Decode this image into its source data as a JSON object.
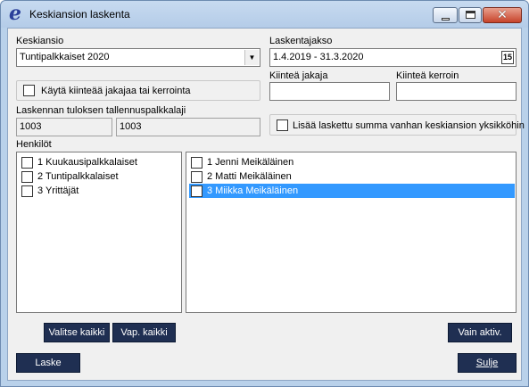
{
  "window": {
    "title": "Keskiansion laskenta",
    "icon": "e-app-icon",
    "close_glyph": "✕"
  },
  "keskiansio": {
    "label": "Keskiansio",
    "value": "Tuntipalkkaiset 2020",
    "dropdown_glyph": "▼"
  },
  "laskentajakso": {
    "label": "Laskentajakso",
    "value": "1.4.2019 - 31.3.2020",
    "calendar_glyph": "15"
  },
  "kiintea_jakaja": {
    "label": "Kiinteä jakaja",
    "value": ""
  },
  "kiintea_kerroin": {
    "label": "Kiinteä kerroin",
    "value": ""
  },
  "use_fixed": {
    "label": "Käytä kiinteää jakajaa tai kerrointa",
    "checked": false
  },
  "tallennus": {
    "label": "Laskennan tuloksen tallennuspalkkalaji",
    "code": "1003",
    "value": "1003"
  },
  "add_sum": {
    "label": "Lisää laskettu summa vanhan keskiansion yksikköhin",
    "checked": false
  },
  "henkilot": {
    "label": "Henkilöt",
    "groups": [
      {
        "label": "1 Kuukausipalkkalaiset",
        "checked": false
      },
      {
        "label": "2 Tuntipalkkalaiset",
        "checked": false
      },
      {
        "label": "3 Yrittäjät",
        "checked": false
      }
    ],
    "persons": [
      {
        "label": "1 Jenni Meikäläinen",
        "checked": false,
        "selected": false
      },
      {
        "label": "2 Matti Meikäläinen",
        "checked": false,
        "selected": false
      },
      {
        "label": "3 Miikka Meikäläinen",
        "checked": true,
        "selected": true
      }
    ]
  },
  "checkmark": "✔",
  "buttons": {
    "select_all": "Valitse kaikki",
    "deselect_all": "Vap. kaikki",
    "only_active": "Vain aktiv.",
    "calculate": "Laske",
    "close": "Sulje"
  }
}
